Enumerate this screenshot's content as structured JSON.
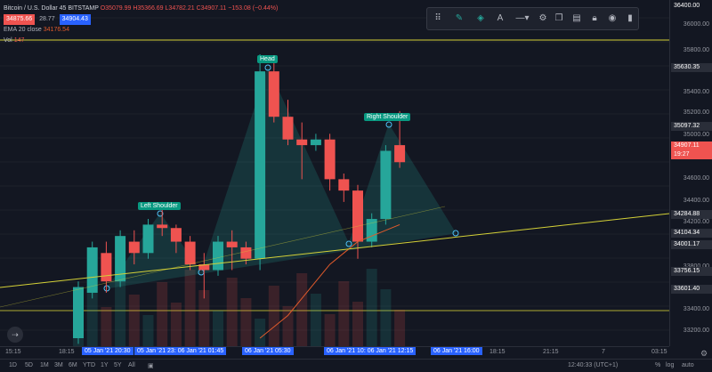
{
  "legend": {
    "symbol": "Bitcoin / U.S. Dollar",
    "interval": "45",
    "exchange": "BITSTAMP",
    "open": "35079.99",
    "high": "H35366.69",
    "low": "L34782.21",
    "close": "34907.11",
    "change": "−153.08 (−0.44%)",
    "bid": "34875.66",
    "spread": "28.77",
    "ask": "34904.43",
    "ema_label": "EMA 20 close",
    "ema_value": "34176.54",
    "vol_label": "Vol",
    "vol_value": "147"
  },
  "price_ticks": [
    "36000.00",
    "35800.00",
    "35400.00",
    "35200.00",
    "35000.00",
    "34600.00",
    "34400.00",
    "34200.00",
    "33800.00",
    "33400.00",
    "33200.00"
  ],
  "price_tags": [
    {
      "text": "36400.00",
      "color": "#2a2e39"
    },
    {
      "text": "35630.35",
      "color": "#2a2e39"
    },
    {
      "text": "35097.32",
      "color": "#2a2e39"
    },
    {
      "text": "34907.11",
      "color": "#ef5350"
    },
    {
      "text": "19:27",
      "color": "#ef5350"
    },
    {
      "text": "34284.88",
      "color": "#2a2e39"
    },
    {
      "text": "34104.34",
      "color": "#2a2e39"
    },
    {
      "text": "34001.17",
      "color": "#2a2e39"
    },
    {
      "text": "33756.15",
      "color": "#2a2e39"
    },
    {
      "text": "33601.40",
      "color": "#2a2e39"
    }
  ],
  "time_labels": [
    {
      "text": "15:15",
      "sel": false
    },
    {
      "text": "18:15",
      "sel": false
    },
    {
      "text": "05 Jan '21  20:30",
      "sel": true
    },
    {
      "text": "05 Jan '21  23: 06 Jan '21  01:45",
      "sel": true
    },
    {
      "text": "06 Jan '21  05:30",
      "sel": true
    },
    {
      "text": "06 Jan '21  10: 06 Jan '21  12:15",
      "sel": true
    },
    {
      "text": "06 Jan '21  16:00",
      "sel": true
    },
    {
      "text": "18:15",
      "sel": false
    },
    {
      "text": "21:15",
      "sel": false
    },
    {
      "text": "7",
      "sel": false
    },
    {
      "text": "03:15",
      "sel": false
    }
  ],
  "ranges": [
    "1D",
    "5D",
    "1M",
    "3M",
    "6M",
    "YTD",
    "1Y",
    "5Y",
    "All"
  ],
  "footer_right": {
    "time": "12:40:33 (UTC+1)",
    "percent": "%",
    "log": "log",
    "auto": "auto"
  },
  "pattern_labels": {
    "head": "Head",
    "left": "Left Shoulder",
    "right": "Right Shoulder"
  },
  "colors": {
    "up": "#26a69a",
    "down": "#ef5350",
    "trendline": "#d4d137",
    "ema": "#e05a2b",
    "pattern_fill": "#26a69a",
    "accent": "#2962ff"
  },
  "toolbar_icons": [
    "drag-handle-icon",
    "pencil-icon",
    "fill-bucket-icon",
    "text-color-icon",
    "line-style-icon",
    "gear-icon",
    "clone-icon",
    "template-icon",
    "lock-icon",
    "visibility-icon",
    "trash-icon"
  ],
  "chart_data": {
    "type": "candlestick",
    "bars": [
      {
        "o": 33200,
        "h": 33700,
        "l": 33150,
        "c": 33650
      },
      {
        "o": 33600,
        "h": 34050,
        "l": 33550,
        "c": 34000
      },
      {
        "o": 33950,
        "h": 34050,
        "l": 33600,
        "c": 33700
      },
      {
        "o": 33700,
        "h": 34150,
        "l": 33650,
        "c": 34100
      },
      {
        "o": 34050,
        "h": 34150,
        "l": 33850,
        "c": 33950
      },
      {
        "o": 33950,
        "h": 34250,
        "l": 33900,
        "c": 34200
      },
      {
        "o": 34200,
        "h": 34400,
        "l": 34100,
        "c": 34170
      },
      {
        "o": 34170,
        "h": 34200,
        "l": 33950,
        "c": 34050
      },
      {
        "o": 34050,
        "h": 34100,
        "l": 33800,
        "c": 33850
      },
      {
        "o": 33850,
        "h": 33950,
        "l": 33550,
        "c": 33800
      },
      {
        "o": 33800,
        "h": 34100,
        "l": 33750,
        "c": 34050
      },
      {
        "o": 34050,
        "h": 34150,
        "l": 33800,
        "c": 34000
      },
      {
        "o": 34000,
        "h": 34050,
        "l": 33850,
        "c": 33900
      },
      {
        "o": 33900,
        "h": 35700,
        "l": 33800,
        "c": 35550
      },
      {
        "o": 35550,
        "h": 35650,
        "l": 35100,
        "c": 35150
      },
      {
        "o": 35150,
        "h": 35300,
        "l": 34900,
        "c": 34950
      },
      {
        "o": 34950,
        "h": 35100,
        "l": 34600,
        "c": 34900
      },
      {
        "o": 34900,
        "h": 35000,
        "l": 34850,
        "c": 34950
      },
      {
        "o": 34950,
        "h": 35000,
        "l": 34500,
        "c": 34600
      },
      {
        "o": 34600,
        "h": 34650,
        "l": 34400,
        "c": 34500
      },
      {
        "o": 34500,
        "h": 34550,
        "l": 33900,
        "c": 34050
      },
      {
        "o": 34050,
        "h": 34300,
        "l": 34000,
        "c": 34250
      },
      {
        "o": 34250,
        "h": 34900,
        "l": 34200,
        "c": 34850
      },
      {
        "o": 34900,
        "h": 35200,
        "l": 34700,
        "c": 34750
      }
    ],
    "ylim": [
      33200,
      36100
    ],
    "ema": [
      null,
      null,
      null,
      null,
      null,
      null,
      null,
      null,
      null,
      null,
      null,
      null,
      null,
      null,
      null,
      33200,
      33300,
      33400,
      33550,
      33700,
      33850,
      33950,
      34050,
      34100,
      34150,
      34200
    ]
  }
}
